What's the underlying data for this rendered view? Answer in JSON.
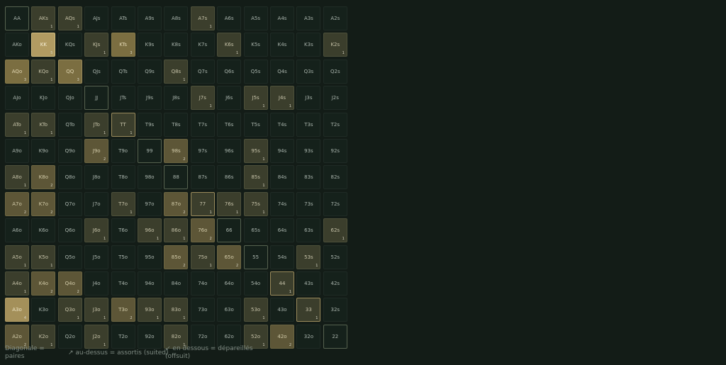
{
  "ranks": [
    "A",
    "K",
    "Q",
    "J",
    "T",
    "9",
    "8",
    "7",
    "6",
    "5",
    "4",
    "3",
    "2"
  ],
  "counts": {
    "AKs": 1,
    "AQs": 1,
    "A7s": 1,
    "KK": 5,
    "KTs": 3,
    "KJs": 1,
    "K6s": 1,
    "K2s": 1,
    "AQo": 3,
    "KQo": 1,
    "QQ": 3,
    "Q8s": 1,
    "A3o": 4,
    "Q3o": 1,
    "J3o": 1,
    "J7s": 1,
    "J5s": 1,
    "J4s": 1,
    "ATo": 1,
    "KTo": 1,
    "JTo": 1,
    "TT": 1,
    "J9o": 2,
    "98s": 2,
    "95s": 1,
    "A8o": 1,
    "K8o": 2,
    "85s": 1,
    "A7o": 2,
    "K7o": 2,
    "T7o": 1,
    "87o": 2,
    "77": 1,
    "76s": 1,
    "75s": 1,
    "J6o": 1,
    "96o": 1,
    "86o": 1,
    "76o": 2,
    "62s": 1,
    "A5o": 1,
    "K5o": 1,
    "85o": 2,
    "75o": 1,
    "65o": 2,
    "53s": 1,
    "A4o": 1,
    "K4o": 2,
    "Q4o": 2,
    "44": 1,
    "A3o_": 0,
    "T3o": 2,
    "93o": 1,
    "83o": 1,
    "53o": 1,
    "33": 1,
    "A2o": 2,
    "K2o": 1,
    "J2o": 1,
    "82o": 1,
    "52o": 1,
    "42o": 2
  },
  "legend": {
    "diagonal": "Diagonale = paires",
    "above": "↗ au-dessus = assortis (suited)",
    "below": "↙ en dessous = dépareillés (offsuit)"
  }
}
